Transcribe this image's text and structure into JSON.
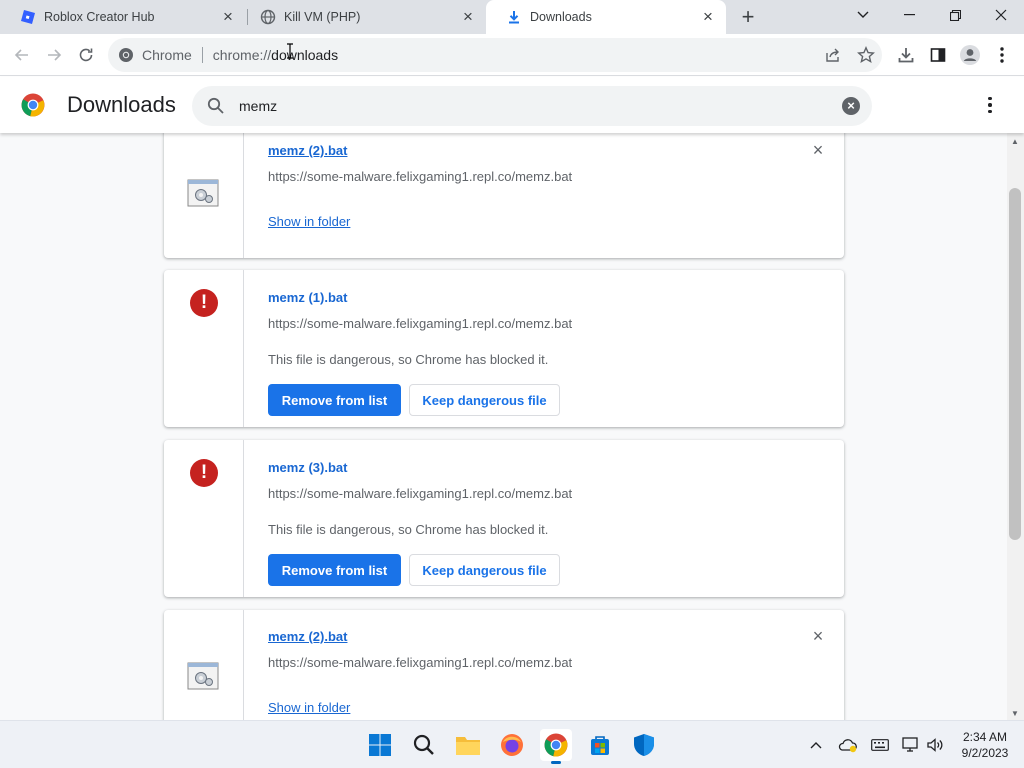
{
  "browser": {
    "tabs": [
      {
        "title": "Roblox Creator Hub",
        "active": false
      },
      {
        "title": "Kill VM (PHP)",
        "active": false
      },
      {
        "title": "Downloads",
        "active": true
      }
    ],
    "omnibox": {
      "chip_label": "Chrome",
      "url_scheme": "chrome://",
      "url_path": "downloads"
    }
  },
  "page": {
    "title": "Downloads",
    "search": {
      "value": "memz"
    }
  },
  "downloads": [
    {
      "name": "memz (2).bat",
      "url": "https://some-malware.felixgaming1.repl.co/memz.bat",
      "action": "Show in folder"
    },
    {
      "name": "memz (1).bat",
      "url": "https://some-malware.felixgaming1.repl.co/memz.bat",
      "message": "This file is dangerous, so Chrome has blocked it.",
      "primary_action": "Remove from list",
      "secondary_action": "Keep dangerous file"
    },
    {
      "name": "memz (3).bat",
      "url": "https://some-malware.felixgaming1.repl.co/memz.bat",
      "message": "This file is dangerous, so Chrome has blocked it.",
      "primary_action": "Remove from list",
      "secondary_action": "Keep dangerous file"
    },
    {
      "name": "memz (2).bat",
      "url": "https://some-malware.felixgaming1.repl.co/memz.bat",
      "action": "Show in folder"
    }
  ],
  "taskbar": {
    "clock": {
      "time": "2:34 AM",
      "date": "9/2/2023"
    }
  },
  "colors": {
    "accent": "#1a73e8",
    "danger": "#c5221f",
    "link": "#1967d2"
  }
}
